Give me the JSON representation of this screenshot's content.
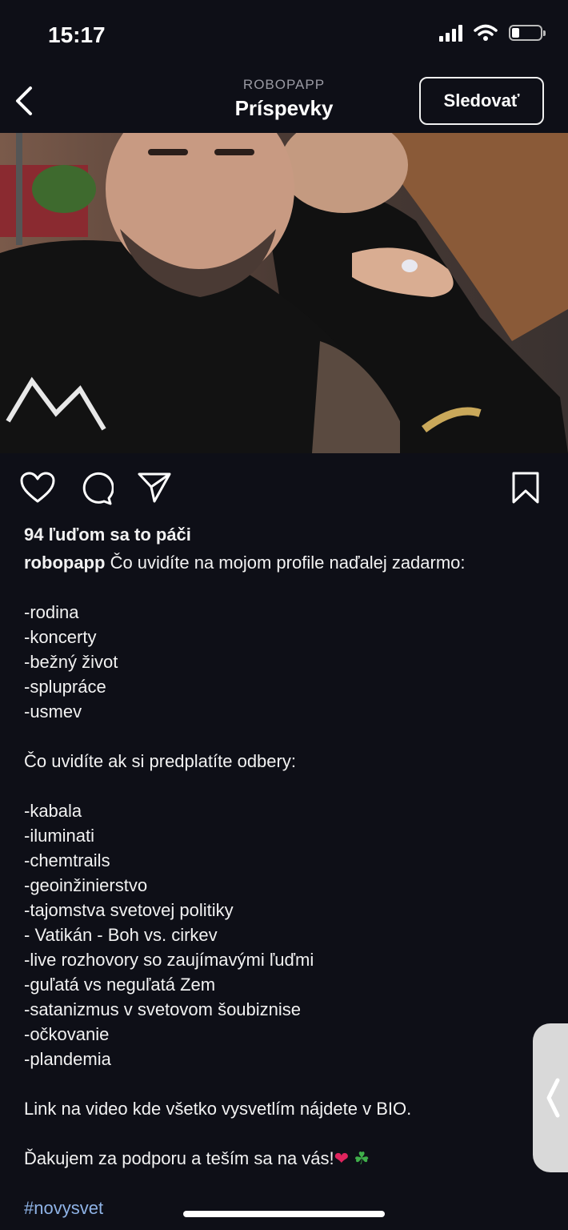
{
  "status": {
    "time": "15:17"
  },
  "header": {
    "account": "ROBOPAPP",
    "title": "Príspevky",
    "follow_label": "Sledovať"
  },
  "post": {
    "likes": "94 ľuďom sa to páči",
    "username": "robopapp",
    "caption_first": "Čo uvidíte na mojom profile naďalej zadarmo:",
    "free_items": [
      "-rodina",
      "-koncerty",
      "-bežný život",
      "-splupráce",
      "-usmev"
    ],
    "paid_intro": "Čo uvidíte ak si predplatíte odbery:",
    "paid_items": [
      "-kabala",
      "-iluminati",
      "-chemtrails",
      "-geoinžinierstvo",
      "-tajomstva svetovej politiky",
      "- Vatikán - Boh vs. cirkev",
      "-live rozhovory so zaujímavými ľuďmi",
      "-guľatá vs neguľatá Zem",
      "-satanizmus v svetovom šoubiznise",
      "-očkovanie",
      "-plandemia"
    ],
    "link_line": "Link na video kde všetko vysvetlím nájdete v BIO.",
    "thanks": "Ďakujem za podporu a teším sa na vás!",
    "emoji_heart": "❤",
    "emoji_clover": "☘",
    "hashtag": "#novysvet"
  },
  "colors": {
    "background": "#0e0f17",
    "hashtag": "#8fb3e6"
  }
}
